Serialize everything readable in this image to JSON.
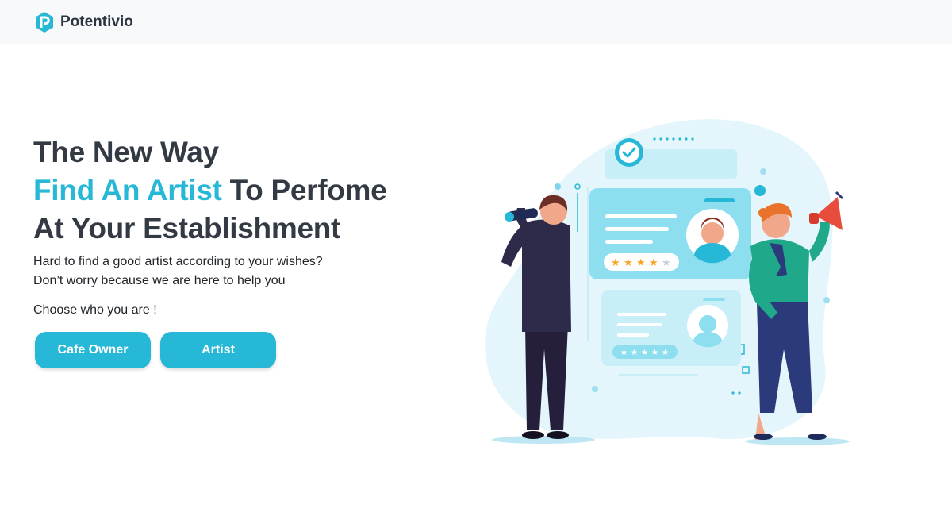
{
  "navbar": {
    "brand_name": "Potentivio",
    "logo_icon": "potentivio-p-logo-icon"
  },
  "hero": {
    "headline_line1": "The New Way",
    "headline_accent": "Find An Artist",
    "headline_line2_rest": " To Perfome",
    "headline_line3": "At Your Establishment",
    "subtext_line1": "Hard to find a good artist according to your wishes?",
    "subtext_line2": "Don’t worry because we are here to help you",
    "choose_label": "Choose who you are !",
    "buttons": {
      "cafe_owner": "Cafe Owner",
      "artist": "Artist"
    }
  },
  "illustration": {
    "name": "recruiter-illustration",
    "rating_stars": 4
  },
  "colors": {
    "accent": "#26b8d6",
    "heading": "#333a44",
    "navbar_bg": "#f8f9fa"
  }
}
